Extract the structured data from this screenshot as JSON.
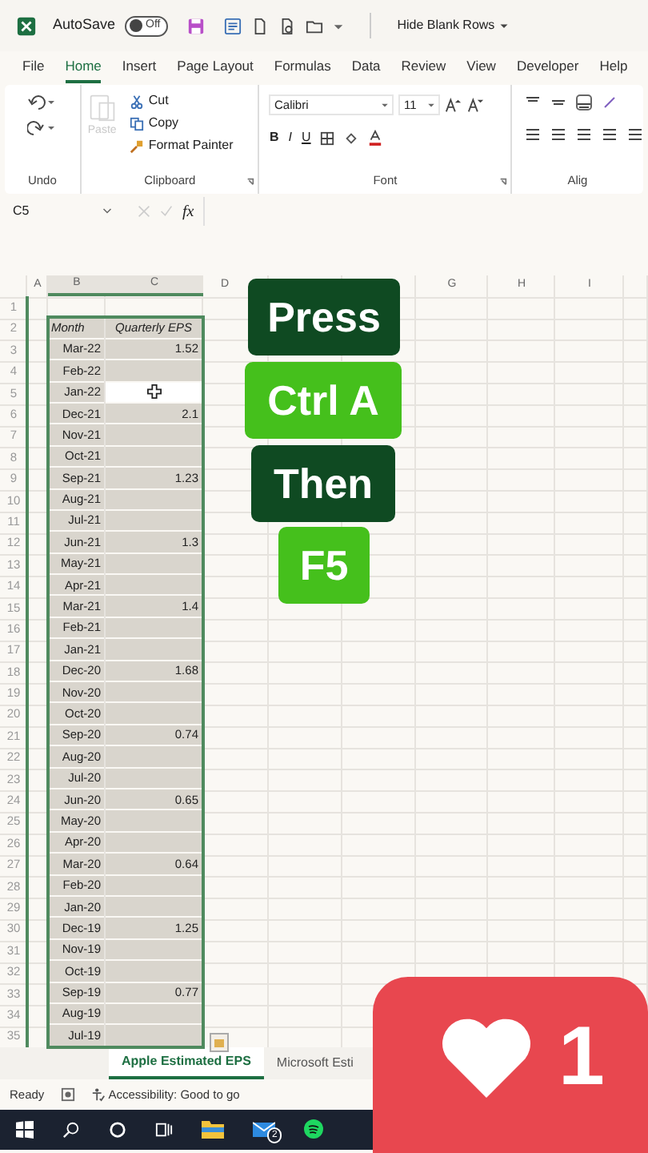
{
  "title_bar": {
    "app_label": "AutoSave",
    "autosave": {
      "on": false,
      "label": "Off"
    },
    "document_title": "Hide Blank Rows"
  },
  "menu_tabs": [
    {
      "label": "File",
      "selected": false
    },
    {
      "label": "Home",
      "selected": true
    },
    {
      "label": "Insert",
      "selected": false
    },
    {
      "label": "Page Layout",
      "selected": false
    },
    {
      "label": "Formulas",
      "selected": false
    },
    {
      "label": "Data",
      "selected": false
    },
    {
      "label": "Review",
      "selected": false
    },
    {
      "label": "View",
      "selected": false
    },
    {
      "label": "Developer",
      "selected": false
    },
    {
      "label": "Help",
      "selected": false
    }
  ],
  "ribbon": {
    "groups": [
      "Undo",
      "Clipboard",
      "Font",
      "Alig"
    ],
    "paste": {
      "label": "Paste",
      "disabled": true
    },
    "cut": "Cut",
    "copy": "Copy",
    "format_painter": "Format Painter",
    "font_name": "Calibri",
    "font_size": "11",
    "bold": "B",
    "italic": "I",
    "underline": "U"
  },
  "formula_bar": {
    "name_box": "C5",
    "fx": "fx"
  },
  "column_headers": [
    "A",
    "B",
    "C",
    "D",
    "G",
    "H",
    "I"
  ],
  "row_numbers": [
    "1",
    "2",
    "3",
    "4",
    "5",
    "6",
    "7",
    "8",
    "9",
    "10",
    "11",
    "12",
    "13",
    "14",
    "15",
    "16",
    "17",
    "18",
    "19",
    "20",
    "21",
    "22",
    "23",
    "24",
    "25",
    "26",
    "27",
    "28",
    "29",
    "30",
    "31",
    "32",
    "33",
    "34",
    "35"
  ],
  "table": {
    "header": {
      "month": "Month",
      "eps": "Quarterly EPS"
    },
    "rows": [
      {
        "month": "Mar-22",
        "eps": "1.52",
        "active": false
      },
      {
        "month": "Feb-22",
        "active": false
      },
      {
        "month": "Jan-22",
        "active": true
      },
      {
        "month": "Dec-21",
        "eps": "2.1",
        "active": false
      },
      {
        "month": "Nov-21",
        "active": false
      },
      {
        "month": "Oct-21",
        "active": false
      },
      {
        "month": "Sep-21",
        "eps": "1.23",
        "active": false
      },
      {
        "month": "Aug-21",
        "active": false
      },
      {
        "month": "Jul-21",
        "active": false
      },
      {
        "month": "Jun-21",
        "eps": "1.3",
        "active": false
      },
      {
        "month": "May-21",
        "active": false
      },
      {
        "month": "Apr-21",
        "active": false
      },
      {
        "month": "Mar-21",
        "eps": "1.4",
        "active": false
      },
      {
        "month": "Feb-21",
        "active": false
      },
      {
        "month": "Jan-21",
        "active": false
      },
      {
        "month": "Dec-20",
        "eps": "1.68",
        "active": false
      },
      {
        "month": "Nov-20",
        "active": false
      },
      {
        "month": "Oct-20",
        "active": false
      },
      {
        "month": "Sep-20",
        "eps": "0.74",
        "active": false
      },
      {
        "month": "Aug-20",
        "active": false
      },
      {
        "month": "Jul-20",
        "active": false
      },
      {
        "month": "Jun-20",
        "eps": "0.65",
        "active": false
      },
      {
        "month": "May-20",
        "active": false
      },
      {
        "month": "Apr-20",
        "active": false
      },
      {
        "month": "Mar-20",
        "eps": "0.64",
        "active": false
      },
      {
        "month": "Feb-20",
        "active": false
      },
      {
        "month": "Jan-20",
        "active": false
      },
      {
        "month": "Dec-19",
        "eps": "1.25",
        "active": false
      },
      {
        "month": "Nov-19",
        "active": false
      },
      {
        "month": "Oct-19",
        "active": false
      },
      {
        "month": "Sep-19",
        "eps": "0.77",
        "active": false
      },
      {
        "month": "Aug-19",
        "active": false
      },
      {
        "month": "Jul-19",
        "active": false
      }
    ]
  },
  "sheet_tabs": [
    {
      "label": "Apple Estimated EPS",
      "selected": true
    },
    {
      "label": "Microsoft Esti",
      "selected": false
    }
  ],
  "status_bar": {
    "ready": "Ready",
    "accessibility": "Accessibility: Good to go"
  },
  "taskbar": {
    "mail_badge": "2"
  },
  "overlay_captions": [
    {
      "text": "Press",
      "kind": "dark"
    },
    {
      "text": "Ctrl A",
      "kind": "light"
    },
    {
      "text": "Then",
      "kind": "dark"
    },
    {
      "text": "F5",
      "kind": "light"
    }
  ],
  "like_counter": {
    "count": "1"
  }
}
